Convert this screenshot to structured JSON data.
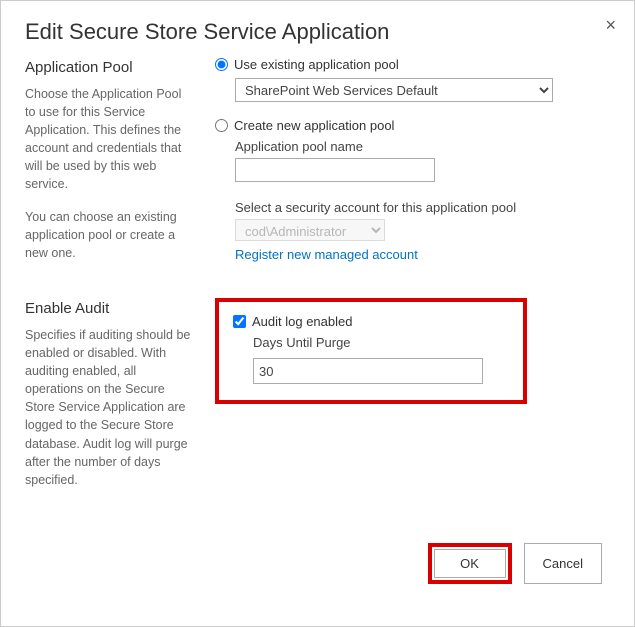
{
  "dialog": {
    "title": "Edit Secure Store Service Application",
    "close_glyph": "×"
  },
  "app_pool": {
    "heading": "Application Pool",
    "desc1": "Choose the Application Pool to use for this Service Application.  This defines the account and credentials that will be used by this web service.",
    "desc2": "You can choose an existing application pool or create a new one.",
    "use_existing_label": "Use existing application pool",
    "pool_selected": "SharePoint Web Services Default",
    "create_new_label": "Create new application pool",
    "pool_name_label": "Application pool name",
    "pool_name_value": "",
    "security_label": "Select a security account for this application pool",
    "security_selected": "cod\\Administrator",
    "register_link": "Register new managed account"
  },
  "audit": {
    "heading": "Enable Audit",
    "desc": "Specifies if auditing should be enabled or disabled. With auditing enabled, all operations on the Secure Store Service Application are logged to the Secure Store database. Audit log will purge after the number of days specified.",
    "enabled_label": "Audit log enabled",
    "enabled_checked": true,
    "days_label": "Days Until Purge",
    "days_value": "30"
  },
  "buttons": {
    "ok": "OK",
    "cancel": "Cancel"
  }
}
